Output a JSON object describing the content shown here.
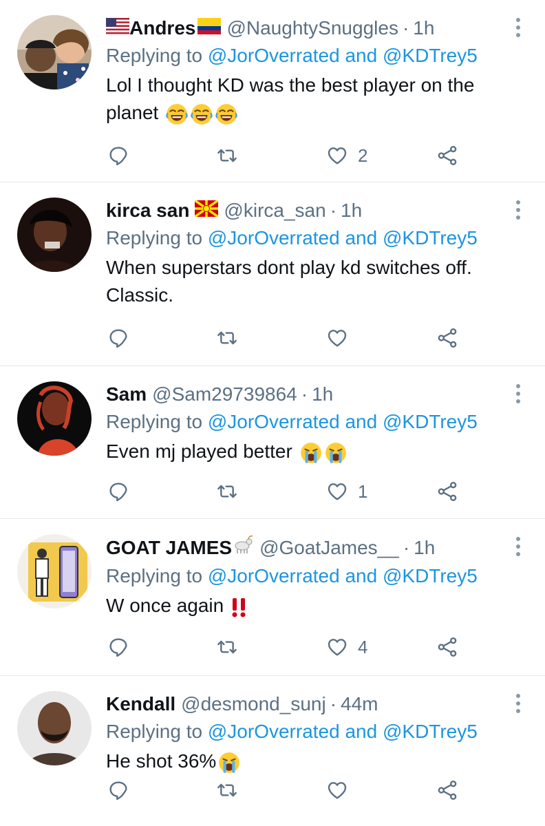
{
  "colors": {
    "link": "#1b95e0",
    "meta": "#5b7083",
    "text": "#0f1419",
    "divider": "#e1e8ed",
    "icon": "#5b7083"
  },
  "tweets": [
    {
      "name": "Andres",
      "handle": "@NaughtySnuggles",
      "time": "1h",
      "flags": [
        "us-flag-icon",
        "colombia-flag-icon"
      ],
      "replying_prefix": "Replying to",
      "replying_to": "@JorOverrated and @KDTrey5",
      "text": "Lol I thought KD was the best player on the planet",
      "emojis": [
        "tears-of-joy-emoji",
        "tears-of-joy-emoji",
        "tears-of-joy-emoji"
      ],
      "likes": "2"
    },
    {
      "name": "kirca san",
      "handle": "@kirca_san",
      "time": "1h",
      "flags": [
        "north-macedonia-flag-icon"
      ],
      "replying_prefix": "Replying to",
      "replying_to": "@JorOverrated and @KDTrey5",
      "text": "When superstars dont play kd switches off. Classic.",
      "likes": ""
    },
    {
      "name": "Sam",
      "handle": "@Sam29739864",
      "time": "1h",
      "replying_prefix": "Replying to",
      "replying_to": "@JorOverrated and @KDTrey5",
      "text": "Even mj played better",
      "emojis": [
        "loudly-crying-emoji",
        "loudly-crying-emoji"
      ],
      "likes": "1"
    },
    {
      "name": "GOAT JAMES",
      "handle": "@GoatJames__",
      "time": "1h",
      "flags": [
        "goat-emoji"
      ],
      "replying_prefix": "Replying to",
      "replying_to": "@JorOverrated and @KDTrey5",
      "text": "W once again",
      "emojis": [
        "double-exclamation-emoji"
      ],
      "likes": "4"
    },
    {
      "name": "Kendall",
      "handle": "@desmond_sunj",
      "time": "44m",
      "replying_prefix": "Replying to",
      "replying_to": "@JorOverrated and @KDTrey5",
      "text": "He shot 36%",
      "emojis": [
        "loudly-crying-emoji"
      ],
      "likes": ""
    }
  ]
}
